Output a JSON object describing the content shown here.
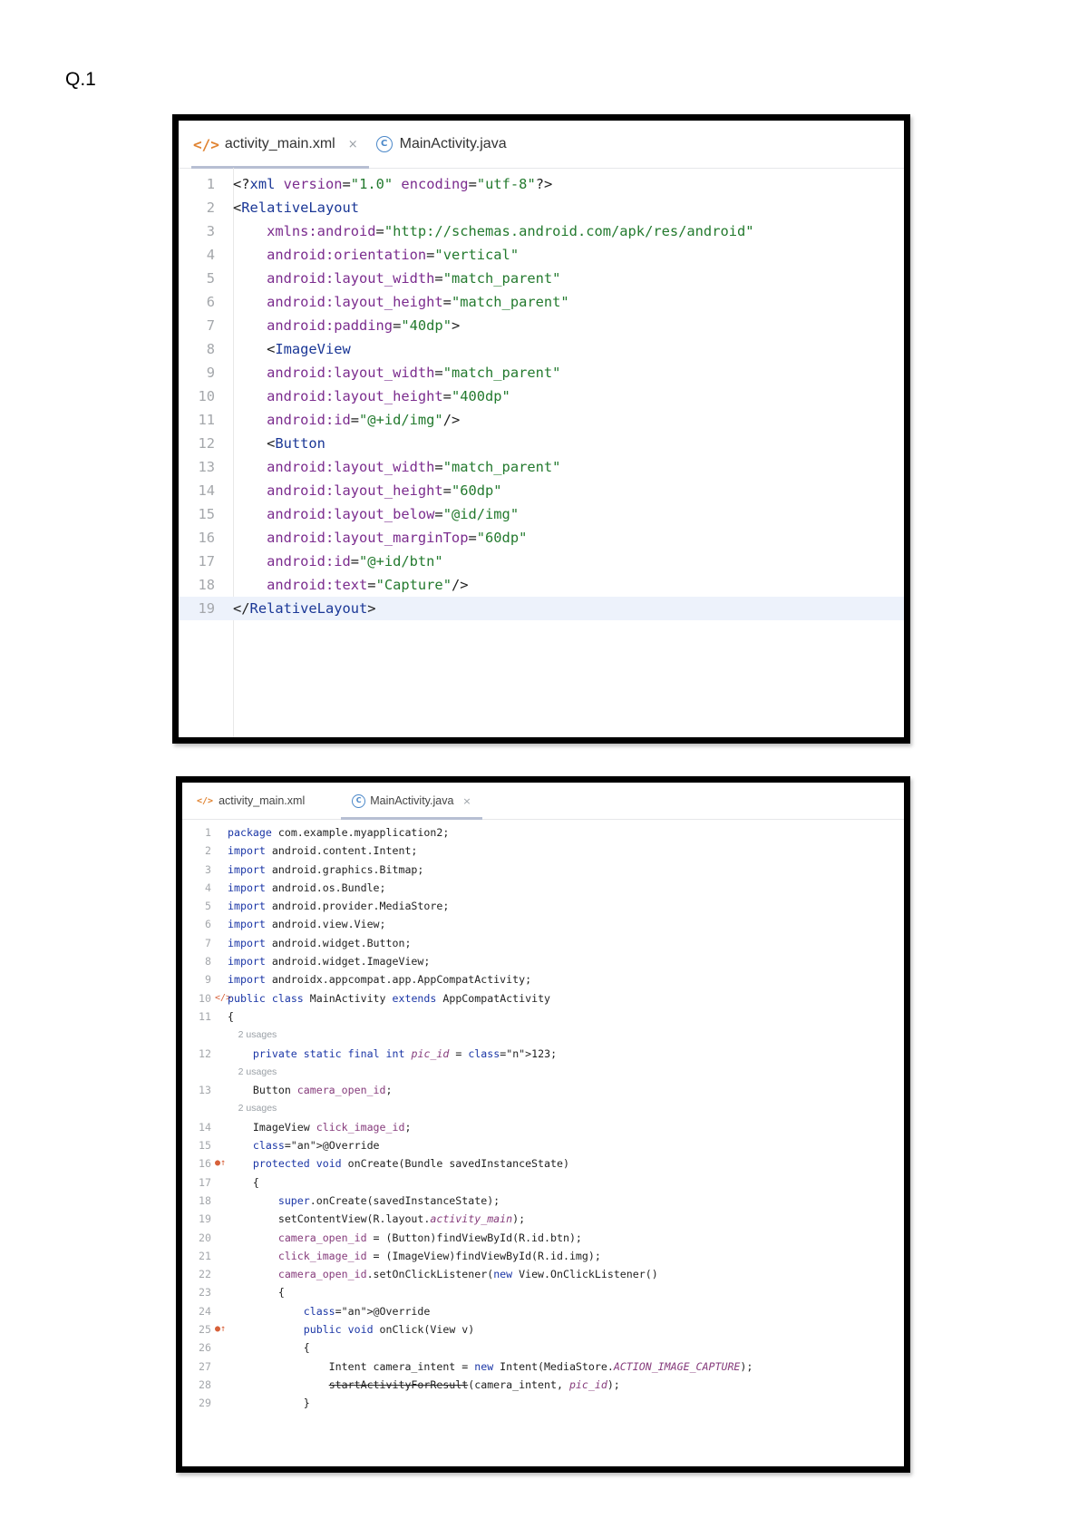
{
  "question_label": "Q.1",
  "editor_xml": {
    "tabs": [
      {
        "icon": "</>",
        "label": "activity_main.xml",
        "close": "×",
        "active": true
      },
      {
        "icon": "C",
        "label": "MainActivity.java",
        "active": false
      }
    ],
    "lines": [
      {
        "n": "1",
        "text": "<?xml version=\"1.0\" encoding=\"utf-8\"?>"
      },
      {
        "n": "2",
        "text": "<RelativeLayout"
      },
      {
        "n": "3",
        "text": "    xmlns:android=\"http://schemas.android.com/apk/res/android\""
      },
      {
        "n": "4",
        "text": "    android:orientation=\"vertical\""
      },
      {
        "n": "5",
        "text": "    android:layout_width=\"match_parent\""
      },
      {
        "n": "6",
        "text": "    android:layout_height=\"match_parent\""
      },
      {
        "n": "7",
        "text": "    android:padding=\"40dp\">"
      },
      {
        "n": "8",
        "text": "    <ImageView"
      },
      {
        "n": "9",
        "text": "    android:layout_width=\"match_parent\""
      },
      {
        "n": "10",
        "text": "    android:layout_height=\"400dp\""
      },
      {
        "n": "11",
        "text": "    android:id=\"@+id/img\"/>"
      },
      {
        "n": "12",
        "text": "    <Button"
      },
      {
        "n": "13",
        "text": "    android:layout_width=\"match_parent\""
      },
      {
        "n": "14",
        "text": "    android:layout_height=\"60dp\""
      },
      {
        "n": "15",
        "text": "    android:layout_below=\"@id/img\""
      },
      {
        "n": "16",
        "text": "    android:layout_marginTop=\"60dp\""
      },
      {
        "n": "17",
        "text": "    android:id=\"@+id/btn\""
      },
      {
        "n": "18",
        "text": "    android:text=\"Capture\"/>"
      },
      {
        "n": "19",
        "text": "</RelativeLayout>"
      }
    ]
  },
  "editor_java": {
    "tabs": [
      {
        "icon": "</>",
        "label": "activity_main.xml",
        "active": false
      },
      {
        "icon": "C",
        "label": "MainActivity.java",
        "close": "×",
        "active": true
      }
    ],
    "lines": [
      {
        "n": "1",
        "text": "package com.example.myapplication2;"
      },
      {
        "n": "2",
        "text": "import android.content.Intent;"
      },
      {
        "n": "3",
        "text": "import android.graphics.Bitmap;"
      },
      {
        "n": "4",
        "text": "import android.os.Bundle;"
      },
      {
        "n": "5",
        "text": "import android.provider.MediaStore;"
      },
      {
        "n": "6",
        "text": "import android.view.View;"
      },
      {
        "n": "7",
        "text": "import android.widget.Button;"
      },
      {
        "n": "8",
        "text": "import android.widget.ImageView;"
      },
      {
        "n": "9",
        "text": "import androidx.appcompat.app.AppCompatActivity;"
      },
      {
        "n": "10",
        "gutter": "</>",
        "text": "public class MainActivity extends AppCompatActivity"
      },
      {
        "n": "11",
        "text": "{"
      },
      {
        "n": "",
        "hint": true,
        "text": "    2 usages"
      },
      {
        "n": "12",
        "text": "    private static final int pic_id = 123;"
      },
      {
        "n": "",
        "hint": true,
        "text": "    2 usages"
      },
      {
        "n": "13",
        "text": "    Button camera_open_id;"
      },
      {
        "n": "",
        "hint": true,
        "text": "    2 usages"
      },
      {
        "n": "14",
        "text": "    ImageView click_image_id;"
      },
      {
        "n": "15",
        "text": "    @Override"
      },
      {
        "n": "16",
        "gutter": "●↑",
        "text": "    protected void onCreate(Bundle savedInstanceState)"
      },
      {
        "n": "17",
        "text": "    {"
      },
      {
        "n": "18",
        "text": "        super.onCreate(savedInstanceState);"
      },
      {
        "n": "19",
        "text": "        setContentView(R.layout.activity_main);"
      },
      {
        "n": "20",
        "text": "        camera_open_id = (Button)findViewById(R.id.btn);"
      },
      {
        "n": "21",
        "text": "        click_image_id = (ImageView)findViewById(R.id.img);"
      },
      {
        "n": "22",
        "text": "        camera_open_id.setOnClickListener(new View.OnClickListener()"
      },
      {
        "n": "23",
        "text": "        {"
      },
      {
        "n": "24",
        "text": "            @Override"
      },
      {
        "n": "25",
        "gutter": "●↑",
        "text": "            public void onClick(View v)"
      },
      {
        "n": "26",
        "text": "            {"
      },
      {
        "n": "27",
        "text": "                Intent camera_intent = new Intent(MediaStore.ACTION_IMAGE_CAPTURE);"
      },
      {
        "n": "28",
        "text": "                startActivityForResult(camera_intent, pic_id);"
      },
      {
        "n": "29",
        "text": "            }"
      }
    ]
  }
}
